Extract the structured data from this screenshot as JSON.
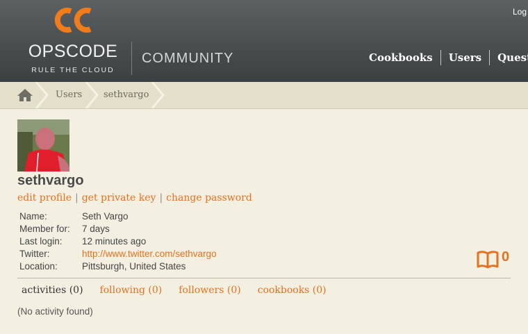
{
  "header": {
    "brand": "OPSCODE",
    "tagline": "RULE THE CLOUD",
    "section": "COMMUNITY",
    "login": "Log",
    "nav": [
      {
        "label": "Cookbooks"
      },
      {
        "label": "Users"
      },
      {
        "label": "Questio"
      }
    ]
  },
  "breadcrumb": {
    "items": [
      {
        "label": "Users"
      },
      {
        "label": "sethvargo"
      }
    ]
  },
  "profile": {
    "username": "sethvargo",
    "actions": {
      "edit": "edit profile",
      "key": "get private key",
      "password": "change password",
      "separator": "|"
    },
    "details": [
      {
        "label": "Name:",
        "value": "Seth Vargo"
      },
      {
        "label": "Member for:",
        "value": "7 days"
      },
      {
        "label": "Last login:",
        "value": "12 minutes ago"
      },
      {
        "label": "Twitter:",
        "value": "http://www.twitter.com/sethvargo"
      },
      {
        "label": "Location:",
        "value": "Pittsburgh, United States"
      }
    ],
    "cookbook_count": "0"
  },
  "tabs": [
    {
      "label": "activities (0)",
      "active": true
    },
    {
      "label": "following (0)"
    },
    {
      "label": "followers (0)"
    },
    {
      "label": "cookbooks (0)"
    }
  ],
  "empty_message": "(No activity found)",
  "colors": {
    "accent": "#e6701e",
    "header": "#4a5052",
    "background": "#f3f0e2"
  }
}
